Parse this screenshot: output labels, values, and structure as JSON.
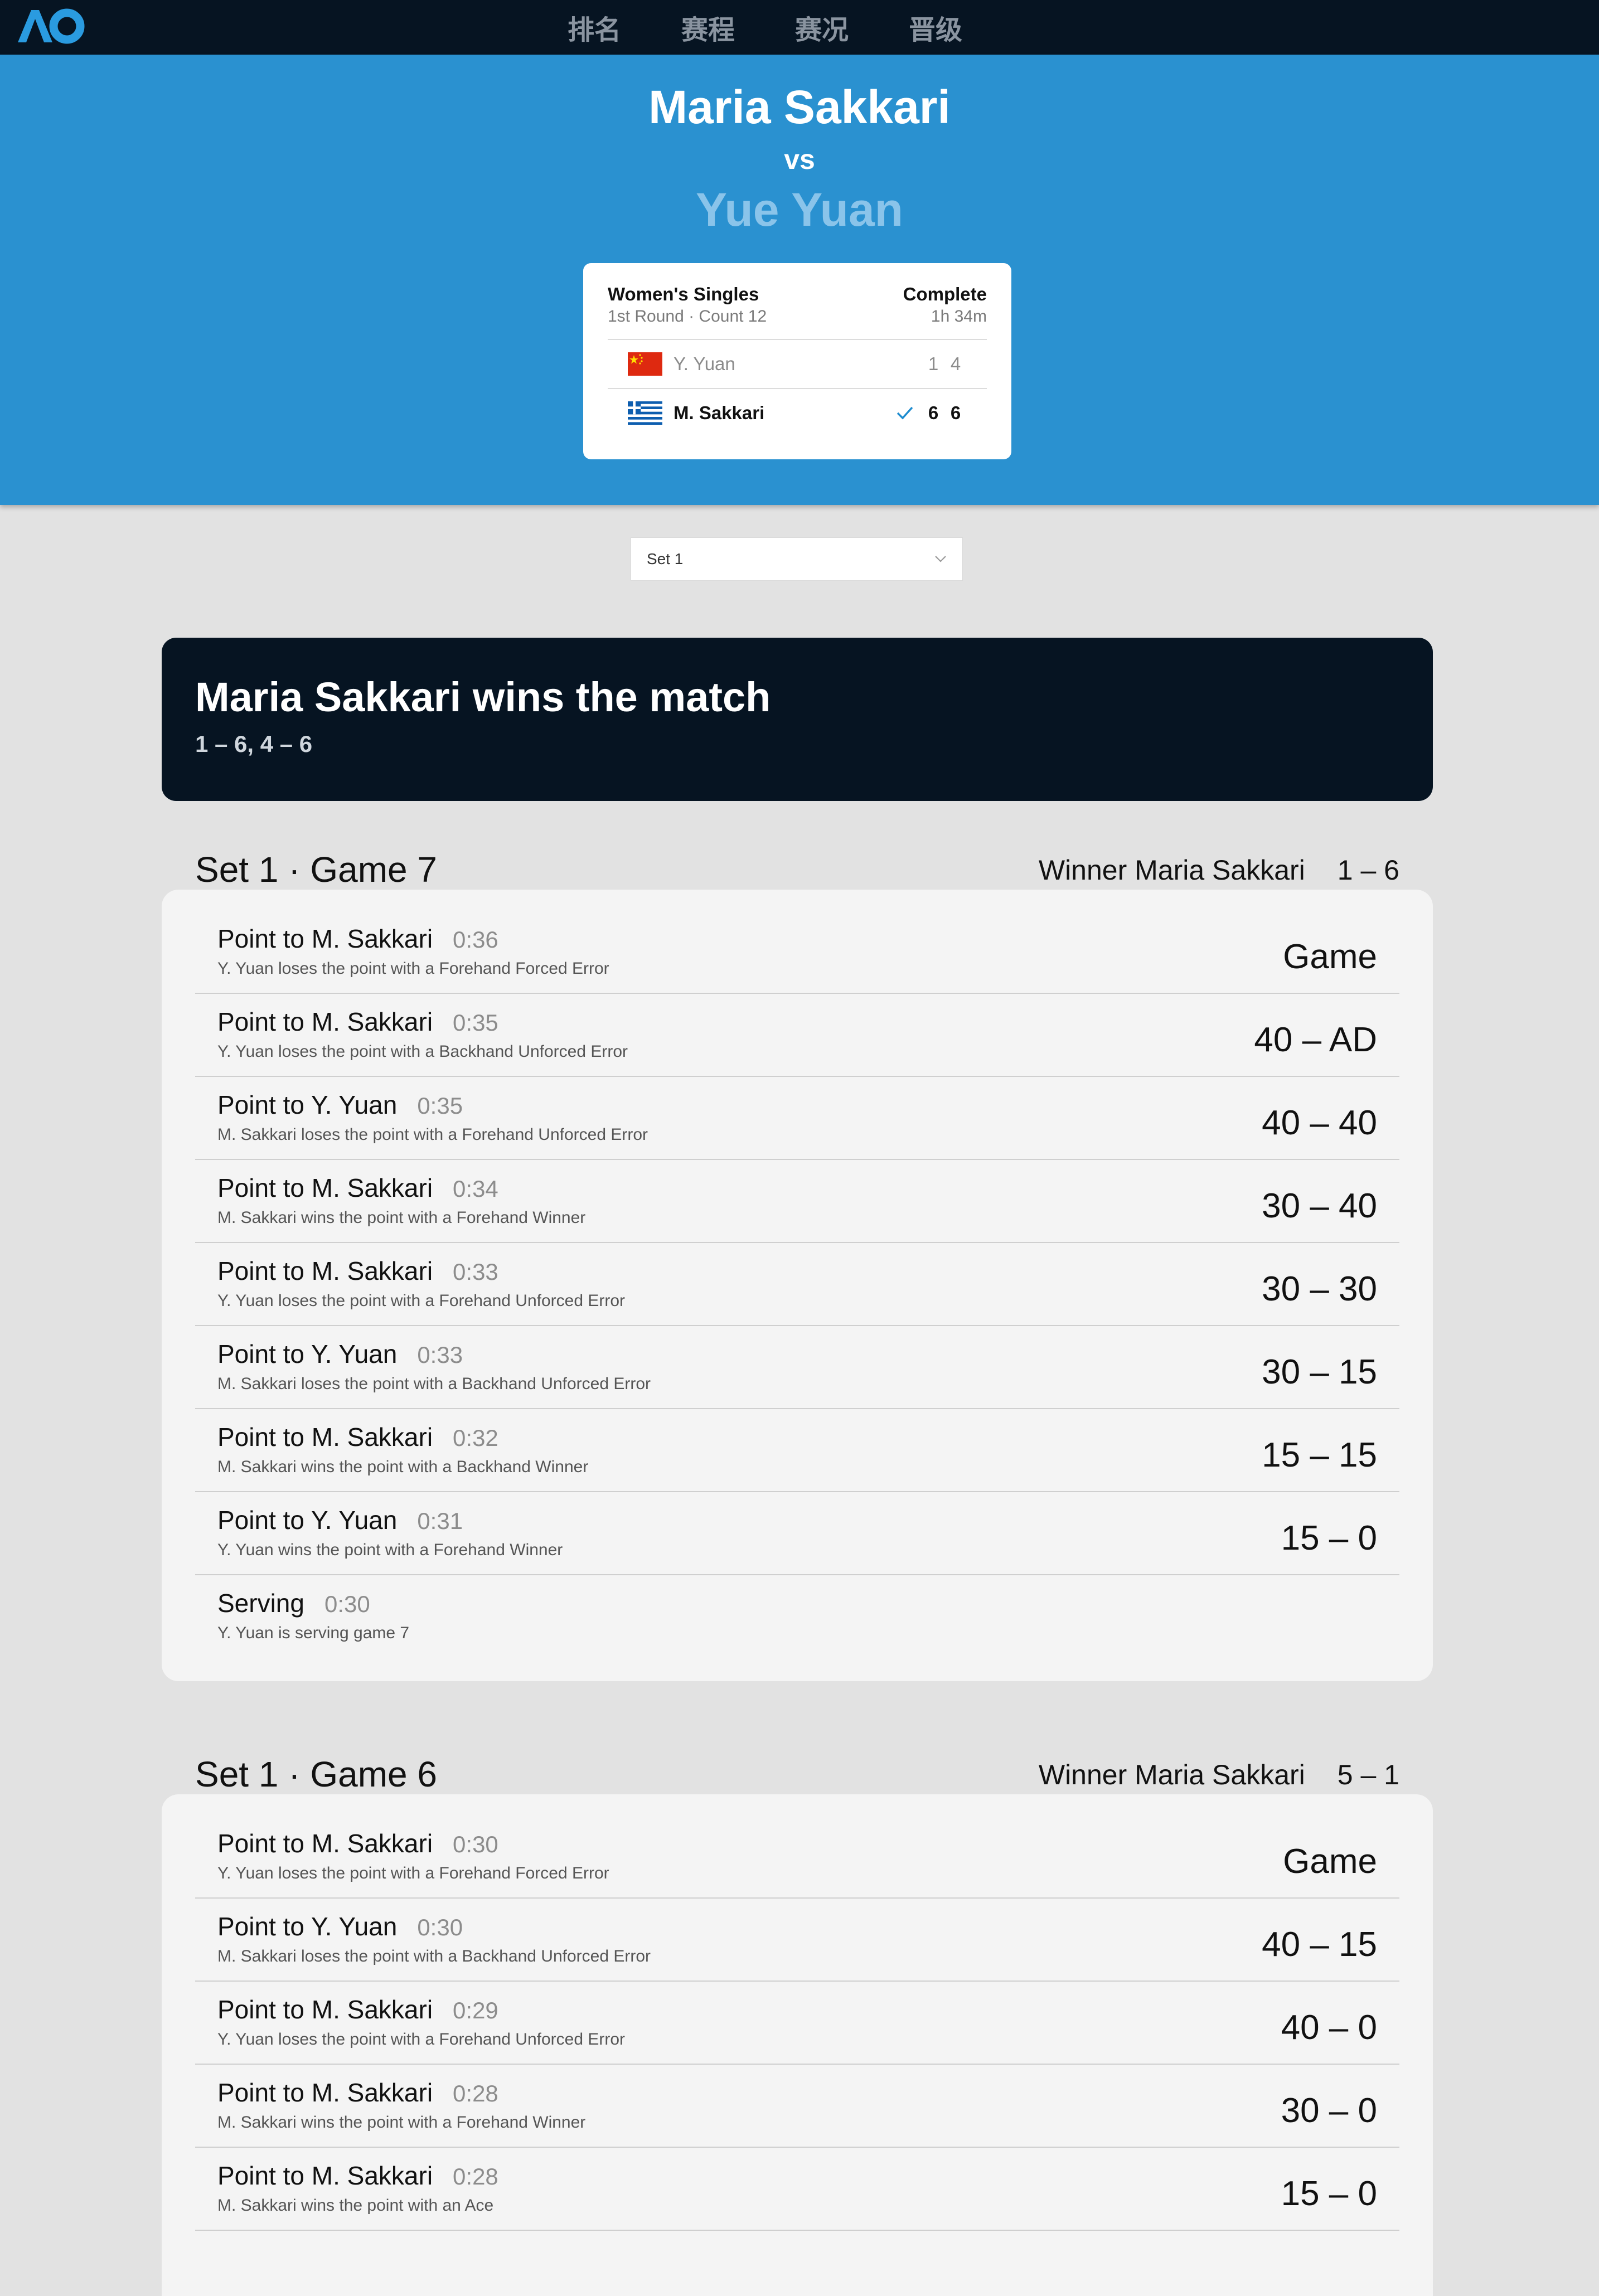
{
  "nav": {
    "logo_text": "AO",
    "items": [
      "排名",
      "赛程",
      "赛况",
      "晋级"
    ]
  },
  "match": {
    "player1": "Maria Sakkari",
    "vs": "vs",
    "player2": "Yue Yuan",
    "event": "Women's Singles",
    "round": "1st Round · Count 12",
    "status": "Complete",
    "duration": "1h 34m",
    "rows": [
      {
        "name": "Y. Yuan",
        "flag": "china-flag-icon",
        "s1": "1",
        "s2": "4",
        "winner": false
      },
      {
        "name": "M. Sakkari",
        "flag": "greece-flag-icon",
        "s1": "6",
        "s2": "6",
        "winner": true
      }
    ]
  },
  "filter": {
    "selected": "Set 1"
  },
  "banner": {
    "title": "Maria Sakkari wins the match",
    "score": "1 – 6, 4 – 6"
  },
  "games": [
    {
      "title": "Set 1 · Game 7",
      "winner": "Winner Maria Sakkari",
      "score": "1 – 6",
      "points": [
        {
          "head": "Point to M. Sakkari",
          "time": "0:36",
          "desc": "Y. Yuan loses the point with a Forehand Forced Error",
          "score": "Game"
        },
        {
          "head": "Point to M. Sakkari",
          "time": "0:35",
          "desc": "Y. Yuan loses the point with a Backhand Unforced Error",
          "score": "40 – AD"
        },
        {
          "head": "Point to Y. Yuan",
          "time": "0:35",
          "desc": "M. Sakkari loses the point with a Forehand Unforced Error",
          "score": "40 – 40"
        },
        {
          "head": "Point to M. Sakkari",
          "time": "0:34",
          "desc": "M. Sakkari wins the point with a Forehand Winner",
          "score": "30 – 40"
        },
        {
          "head": "Point to M. Sakkari",
          "time": "0:33",
          "desc": "Y. Yuan loses the point with a Forehand Unforced Error",
          "score": "30 – 30"
        },
        {
          "head": "Point to Y. Yuan",
          "time": "0:33",
          "desc": "M. Sakkari loses the point with a Backhand Unforced Error",
          "score": "30 – 15"
        },
        {
          "head": "Point to M. Sakkari",
          "time": "0:32",
          "desc": "M. Sakkari wins the point with a Backhand Winner",
          "score": "15 – 15"
        },
        {
          "head": "Point to Y. Yuan",
          "time": "0:31",
          "desc": "Y. Yuan wins the point with a Forehand Winner",
          "score": "15 – 0"
        },
        {
          "head": "Serving",
          "time": "0:30",
          "desc": "Y. Yuan is serving game 7",
          "score": ""
        }
      ]
    },
    {
      "title": "Set 1 · Game 6",
      "winner": "Winner Maria Sakkari",
      "score": "5 – 1",
      "points": [
        {
          "head": "Point to M. Sakkari",
          "time": "0:30",
          "desc": "Y. Yuan loses the point with a Forehand Forced Error",
          "score": "Game"
        },
        {
          "head": "Point to Y. Yuan",
          "time": "0:30",
          "desc": "M. Sakkari loses the point with a Backhand Unforced Error",
          "score": "40 – 15"
        },
        {
          "head": "Point to M. Sakkari",
          "time": "0:29",
          "desc": "Y. Yuan loses the point with a Forehand Unforced Error",
          "score": "40 – 0"
        },
        {
          "head": "Point to M. Sakkari",
          "time": "0:28",
          "desc": "M. Sakkari wins the point with a Forehand Winner",
          "score": "30 – 0"
        },
        {
          "head": "Point to M. Sakkari",
          "time": "0:28",
          "desc": "M. Sakkari wins the point with an Ace",
          "score": "15 – 0"
        }
      ]
    }
  ]
}
